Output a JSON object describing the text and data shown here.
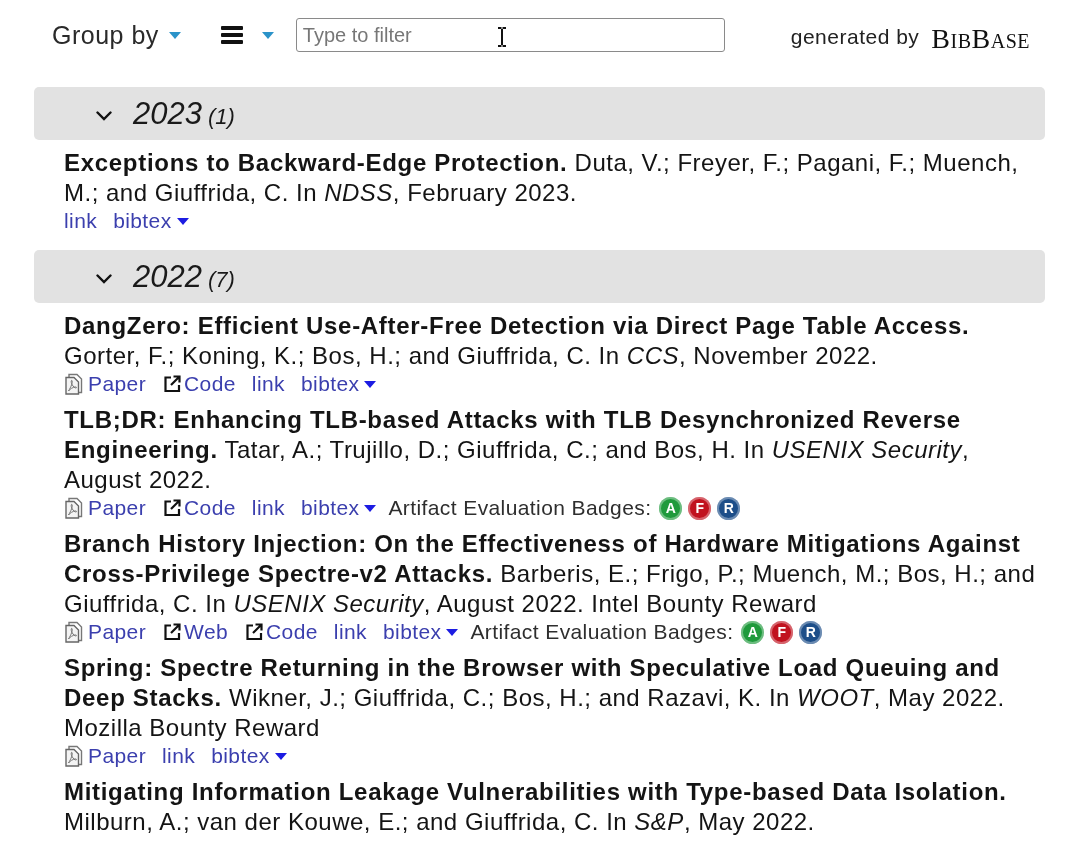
{
  "toolbar": {
    "group_by": {
      "label": "Group by"
    },
    "filter": {
      "placeholder": "Type to filter"
    },
    "generated_by": {
      "label": "generated by",
      "logo": "BibBase"
    }
  },
  "groups": [
    {
      "year": "2023",
      "count": "(1)",
      "expanded": true,
      "entries": [
        {
          "text": "**Exceptions to Backward-Edge Protection.** Duta, V.; Freyer, F.; Pagani, F.; Muench, M.; and Giuffrida, C. In *NDSS*, February 2023.",
          "links": [
            {
              "kind": "plain",
              "label": "link"
            },
            {
              "kind": "dropdown",
              "label": "bibtex"
            }
          ]
        }
      ]
    },
    {
      "year": "2022",
      "count": "(7)",
      "expanded": true,
      "entries": [
        {
          "text": "**DangZero: Efficient Use-After-Free Detection via Direct Page Table Access.** Gorter, F.; Koning, K.; Bos, H.; and Giuffrida, C. In *CCS*, November 2022.",
          "links": [
            {
              "kind": "pdf",
              "label": "Paper"
            },
            {
              "kind": "external",
              "label": "Code"
            },
            {
              "kind": "plain",
              "label": "link"
            },
            {
              "kind": "dropdown",
              "label": "bibtex"
            }
          ]
        },
        {
          "text": "**TLB;DR: Enhancing TLB-based Attacks with TLB Desynchronized Reverse Engineering.** Tatar, A.; Trujillo, D.; Giuffrida, C.; and Bos, H. In *USENIX Security*, August 2022.",
          "links": [
            {
              "kind": "pdf",
              "label": "Paper"
            },
            {
              "kind": "external",
              "label": "Code"
            },
            {
              "kind": "plain",
              "label": "link"
            },
            {
              "kind": "dropdown",
              "label": "bibtex"
            }
          ],
          "badges": {
            "label": "Artifact Evaluation Badges:",
            "items": [
              {
                "letter": "A",
                "color": "#1f9a3c"
              },
              {
                "letter": "F",
                "color": "#c1121f"
              },
              {
                "letter": "R",
                "color": "#1d4e89"
              }
            ]
          }
        },
        {
          "text": "**Branch History Injection: On the Effectiveness of Hardware Mitigations Against Cross-Privilege Spectre-v2 Attacks.** Barberis, E.; Frigo, P.; Muench, M.; Bos, H.; and Giuffrida, C. In *USENIX Security*, August 2022. Intel Bounty Reward",
          "links": [
            {
              "kind": "pdf",
              "label": "Paper"
            },
            {
              "kind": "external",
              "label": "Web"
            },
            {
              "kind": "external",
              "label": "Code"
            },
            {
              "kind": "plain",
              "label": "link"
            },
            {
              "kind": "dropdown",
              "label": "bibtex"
            }
          ],
          "badges": {
            "label": "Artifact Evaluation Badges:",
            "items": [
              {
                "letter": "A",
                "color": "#1f9a3c"
              },
              {
                "letter": "F",
                "color": "#c1121f"
              },
              {
                "letter": "R",
                "color": "#1d4e89"
              }
            ]
          }
        },
        {
          "text": "**Spring: Spectre Returning in the Browser with Speculative Load Queuing and Deep Stacks.** Wikner, J.; Giuffrida, C.; Bos, H.; and Razavi, K. In *WOOT*, May 2022. Mozilla Bounty Reward",
          "links": [
            {
              "kind": "pdf",
              "label": "Paper"
            },
            {
              "kind": "plain",
              "label": "link"
            },
            {
              "kind": "dropdown",
              "label": "bibtex"
            }
          ]
        },
        {
          "text": "**Mitigating Information Leakage Vulnerabilities with Type-based Data Isolation.** Milburn, A.; van der Kouwe, E.; and Giuffrida, C. In *S&P*, May 2022."
        }
      ]
    }
  ]
}
